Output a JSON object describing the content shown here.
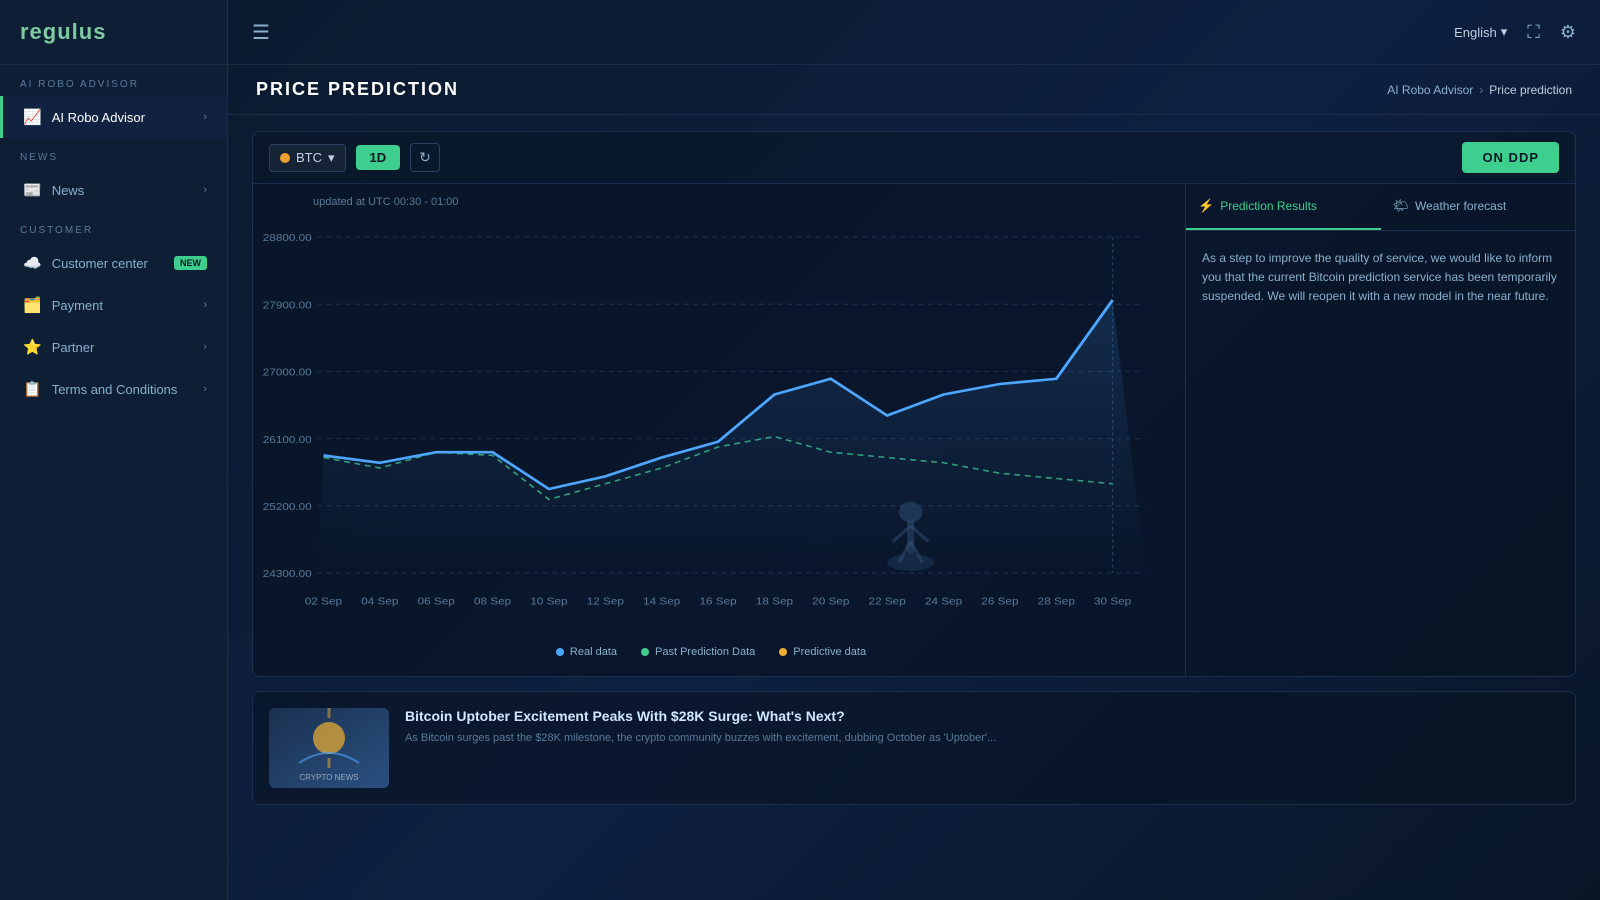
{
  "app": {
    "logo": "regulus",
    "language": "English"
  },
  "sidebar": {
    "section_ai": "AI ROBO ADVISOR",
    "section_news": "NEWS",
    "section_customer": "CUSTOMER",
    "items": [
      {
        "id": "ai-robo-advisor",
        "label": "AI Robo Advisor",
        "icon": "📈",
        "active": true
      },
      {
        "id": "news",
        "label": "News",
        "icon": "📰",
        "active": false
      },
      {
        "id": "customer-center",
        "label": "Customer center",
        "icon": "☁️",
        "badge": "New",
        "active": false
      },
      {
        "id": "payment",
        "label": "Payment",
        "icon": "🗂️",
        "active": false
      },
      {
        "id": "partner",
        "label": "Partner",
        "icon": "⭐",
        "active": false
      },
      {
        "id": "terms",
        "label": "Terms and Conditions",
        "icon": "📋",
        "active": false
      }
    ]
  },
  "topbar": {
    "hamburger_icon": "☰",
    "language": "English",
    "fullscreen_icon": "⛶",
    "settings_icon": "⚙"
  },
  "page": {
    "title": "PRICE PREDICTION",
    "breadcrumb_root": "AI Robo Advisor",
    "breadcrumb_current": "Price prediction"
  },
  "toolbar": {
    "coin": "BTC",
    "timeframe": "1D",
    "on_ddp_label": "ON DDP"
  },
  "chart": {
    "updated": "updated at UTC 00:30 - 01:00",
    "y_labels": [
      "24300.00",
      "25200.00",
      "26100.00",
      "27000.00",
      "27900.00",
      "28800.00"
    ],
    "x_labels": [
      "02 Sep",
      "04 Sep",
      "06 Sep",
      "08 Sep",
      "10 Sep",
      "12 Sep",
      "14 Sep",
      "16 Sep",
      "18 Sep",
      "20 Sep",
      "22 Sep",
      "24 Sep",
      "26 Sep",
      "28 Sep",
      "30 Sep"
    ],
    "legend": [
      {
        "label": "Real data",
        "color": "#4da6ff"
      },
      {
        "label": "Past Prediction Data",
        "color": "#5ecf8e"
      },
      {
        "label": "Predictive data",
        "color": "#f0b030"
      }
    ]
  },
  "right_panel": {
    "tabs": [
      {
        "id": "prediction",
        "label": "Prediction Results",
        "icon": "⚡",
        "active": true
      },
      {
        "id": "weather",
        "label": "Weather forecast",
        "icon": "🌤",
        "active": false
      }
    ],
    "prediction_text": "As a step to improve the quality of service, we would like to inform you that the current Bitcoin prediction service has been temporarily suspended. We will reopen it with a new model in the near future."
  },
  "news": {
    "title": "Bitcoin Uptober Excitement Peaks With $28K Surge: What's Next?",
    "excerpt": "As Bitcoin surges past the $28K milestone, the crypto community buzzes with excitement, dubbing October as 'Uptober'..."
  }
}
